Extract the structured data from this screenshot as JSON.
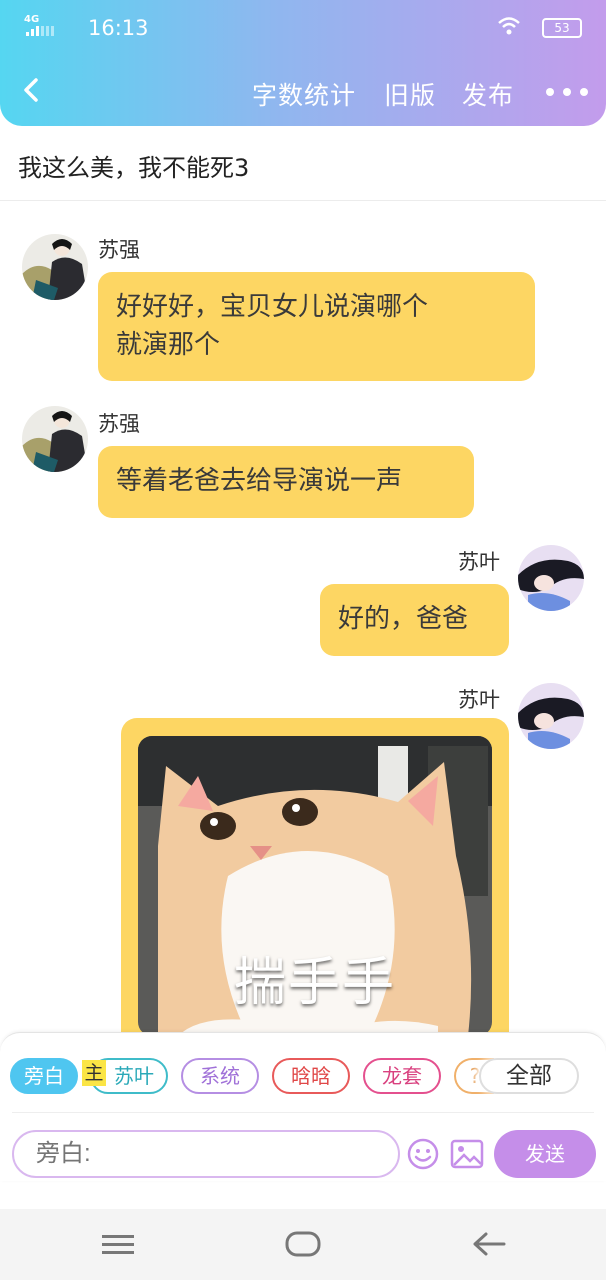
{
  "status_bar": {
    "network": "4G",
    "time": "16:13",
    "battery": "53"
  },
  "nav": {
    "back_icon": "chevron-left-icon",
    "word_count": "字数统计",
    "old_version": "旧版",
    "publish": "发布",
    "more_icon": "more-dots-icon"
  },
  "title": "我这么美，我不能死3",
  "messages": [
    {
      "sender": "苏强",
      "text": "好好好，宝贝女儿说演哪个就演那个",
      "line1": "好好好，宝贝女儿说演哪个",
      "line2": "就演那个",
      "side": "left"
    },
    {
      "sender": "苏强",
      "text": "等着老爸去给导演说一声",
      "side": "left"
    },
    {
      "sender": "苏叶",
      "text": "好的，爸爸",
      "side": "right"
    },
    {
      "sender": "苏叶",
      "image_caption": "揣手手",
      "side": "right"
    }
  ],
  "roles": {
    "narration": "旁白",
    "master_tag": "主",
    "su_ye": "苏叶",
    "system": "系统",
    "anan": "晗晗",
    "longtao": "龙套",
    "more_chip": "?",
    "all": "全部"
  },
  "input": {
    "placeholder": "旁白:"
  },
  "send_label": "发送",
  "colors": {
    "bubble": "#fdd663",
    "accent_blue": "#4fc6f0",
    "accent_purple": "#c58ee9"
  }
}
